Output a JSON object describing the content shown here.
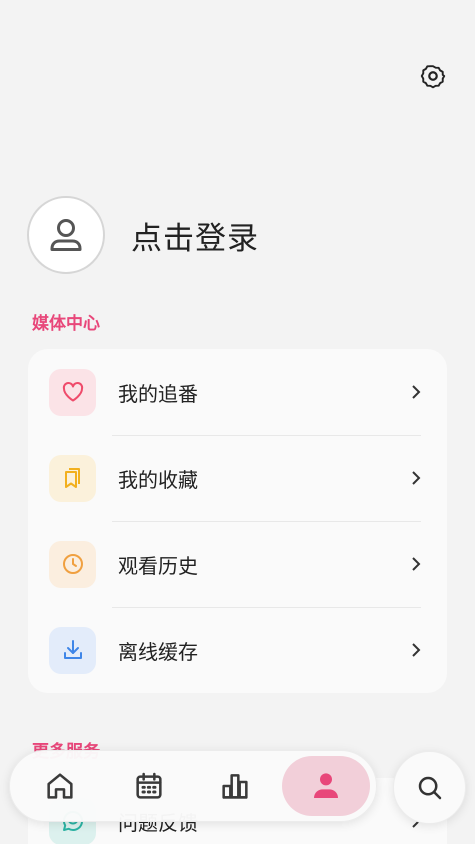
{
  "header": {
    "settings_icon": "gear-icon"
  },
  "profile": {
    "login_label": "点击登录",
    "avatar_icon": "user-outline-icon"
  },
  "media_center": {
    "title": "媒体中心",
    "items": [
      {
        "label": "我的追番",
        "icon": "heart-icon",
        "color": "#ef4b6b",
        "bg": "#fbe3e7"
      },
      {
        "label": "我的收藏",
        "icon": "bookmarks-icon",
        "color": "#f2b01e",
        "bg": "#fbf1db"
      },
      {
        "label": "观看历史",
        "icon": "clock-icon",
        "color": "#f0a040",
        "bg": "#fbeedf"
      },
      {
        "label": "离线缓存",
        "icon": "download-icon",
        "color": "#3f86e8",
        "bg": "#e3ecfa"
      }
    ]
  },
  "more_services": {
    "title": "更多服务",
    "items": [
      {
        "label": "问题反馈",
        "icon": "feedback-icon",
        "color": "#2bb3a3",
        "bg": "#dcf1ee"
      }
    ]
  },
  "bottom_nav": {
    "items": [
      {
        "name": "home",
        "icon": "home-icon",
        "active": false
      },
      {
        "name": "calendar",
        "icon": "calendar-icon",
        "active": false
      },
      {
        "name": "ranking",
        "icon": "bar-chart-icon",
        "active": false
      },
      {
        "name": "profile",
        "icon": "person-icon",
        "active": true
      }
    ],
    "search_icon": "search-icon"
  },
  "colors": {
    "accent": "#e8477a",
    "active_bg": "#f2cfd9",
    "icon_gray": "#3a3a3a"
  }
}
